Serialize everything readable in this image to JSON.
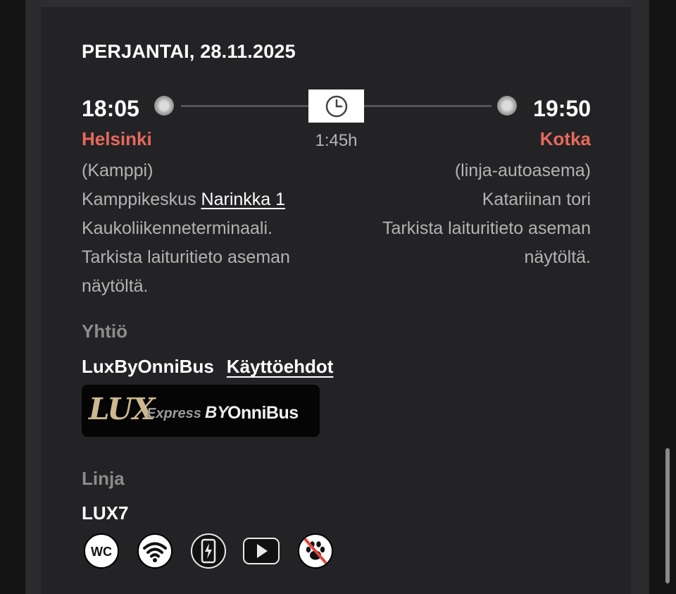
{
  "trip": {
    "date": "PERJANTAI, 28.11.2025",
    "duration": "1:45h"
  },
  "departure": {
    "time": "18:05",
    "city": "Helsinki",
    "area": "(Kamppi)",
    "stop_prefix": "Kamppikeskus ",
    "stop_link": "Narinkka 1",
    "detail_1": "Kaukoliikenneterminaali.",
    "detail_2": "Tarkista laituritieto aseman",
    "detail_3": "näytöltä."
  },
  "arrival": {
    "time": "19:50",
    "city": "Kotka",
    "area": "(linja-autoasema)",
    "stop": "Katariinan tori",
    "detail_1": "Tarkista laituritieto aseman",
    "detail_2": "näytöltä."
  },
  "company": {
    "label": "Yhtiö",
    "name": "LuxByOnniBus",
    "terms_link": "Käyttöehdot",
    "logo": {
      "lux": "LUX",
      "express": "Express",
      "by": "BY",
      "onnibus": "OnniBus"
    }
  },
  "line": {
    "label": "Linja",
    "code": "LUX7"
  },
  "amenities": [
    {
      "icon": "wc-icon",
      "text": "WC"
    },
    {
      "icon": "wifi-icon"
    },
    {
      "icon": "phone-charging-icon"
    },
    {
      "icon": "video-play-icon"
    },
    {
      "icon": "no-pets-icon"
    }
  ],
  "colors": {
    "accent_city": "#e8695c",
    "card_bg": "#232326",
    "muted_text": "#b3b3b3"
  }
}
